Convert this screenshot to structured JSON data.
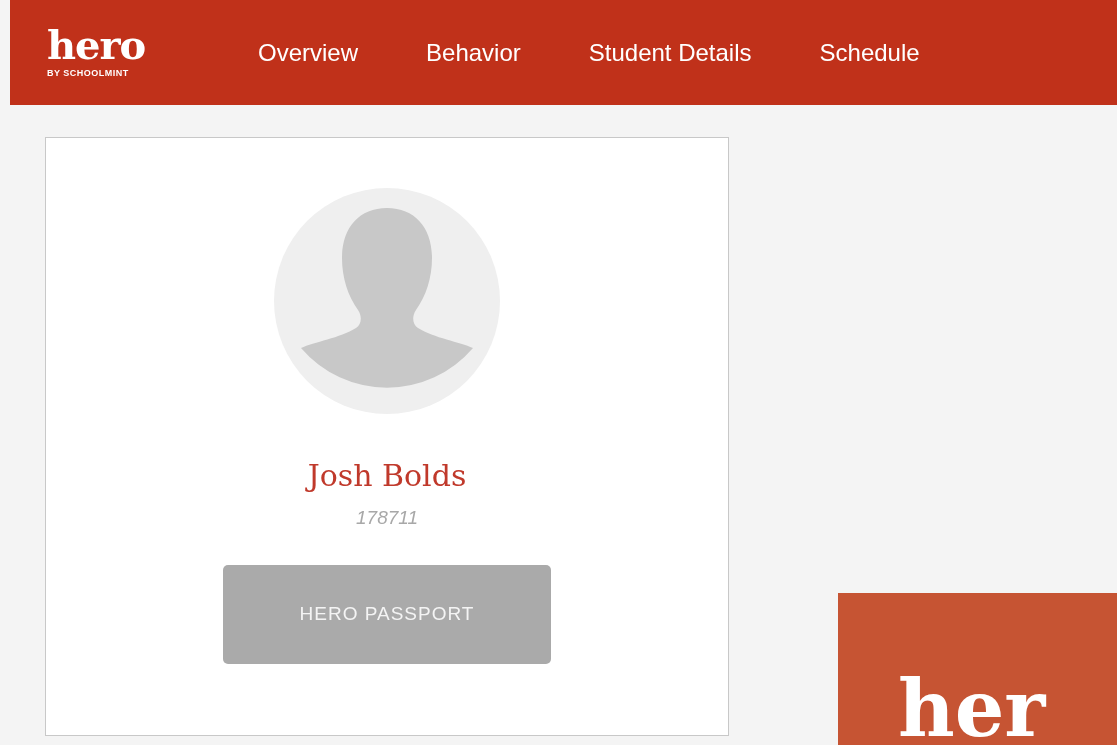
{
  "header": {
    "logo": {
      "wordmark": "hero",
      "tagline": "BY SCHOOLMINT"
    },
    "nav": [
      {
        "label": "Overview"
      },
      {
        "label": "Behavior"
      },
      {
        "label": "Student Details"
      },
      {
        "label": "Schedule"
      }
    ]
  },
  "profile": {
    "name": "Josh Bolds",
    "student_id": "178711",
    "button": "HERO PASSPORT"
  },
  "passport_preview": {
    "text": "her"
  }
}
